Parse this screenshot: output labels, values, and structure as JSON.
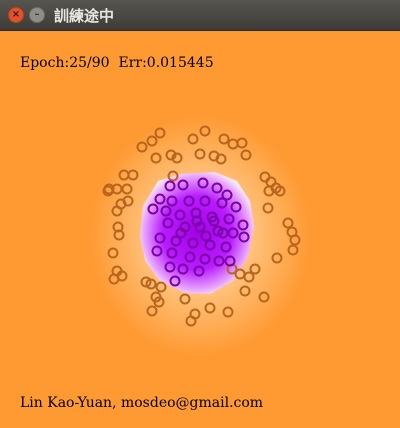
{
  "window": {
    "title": "訓練途中",
    "close_glyph": "×",
    "minimize_glyph": "–"
  },
  "status": {
    "epoch_label": "Epoch:",
    "epoch_current": "25",
    "epoch_total": "90",
    "error_label": "Err:",
    "error_value": "0.015445"
  },
  "footer": {
    "credit": "Lin Kao-Yuan, mosdeo@gmail.com"
  },
  "colors": {
    "background": "#ff9a33",
    "outer_class": "#b8651e",
    "inner_class": "#7a00a8",
    "inner_region": "#b000ff"
  }
}
